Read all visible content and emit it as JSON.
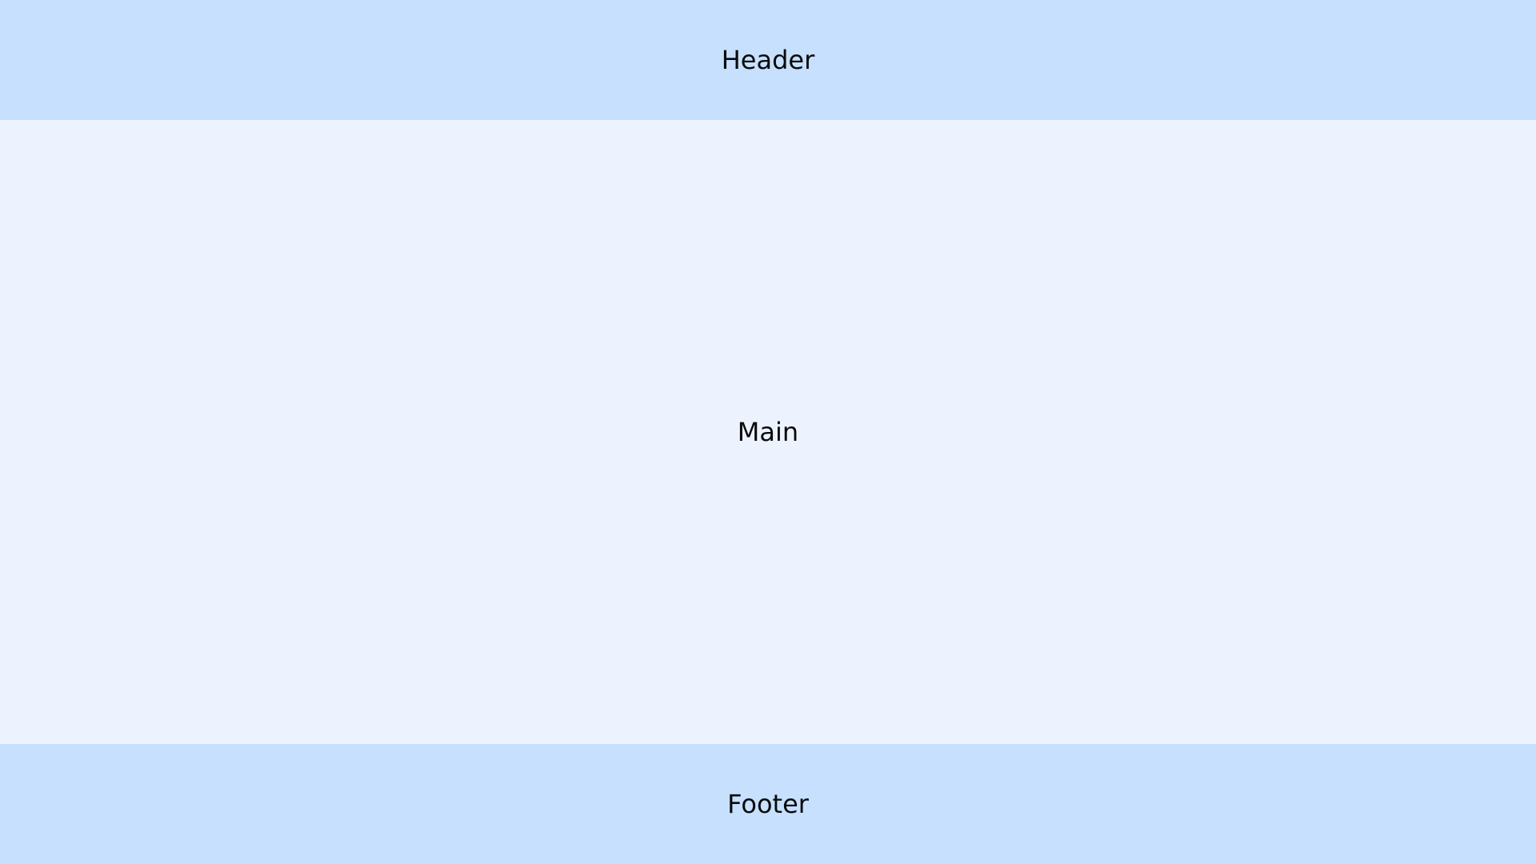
{
  "header": {
    "label": "Header",
    "bg_color": "#c6e0fe"
  },
  "main": {
    "label": "Main",
    "bg_color": "#ecf3ff"
  },
  "footer": {
    "label": "Footer",
    "bg_color": "#c6e0fe"
  }
}
